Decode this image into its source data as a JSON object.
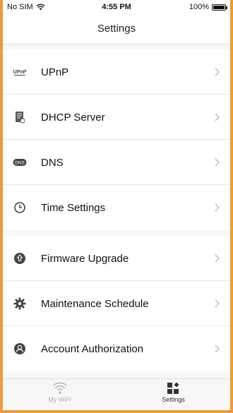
{
  "status_bar": {
    "carrier": "No SIM",
    "time": "4:55 PM",
    "battery": "100%"
  },
  "nav": {
    "title": "Settings"
  },
  "groups": [
    [
      {
        "label": "UPnP",
        "icon": "upnp-icon"
      },
      {
        "label": "DHCP Server",
        "icon": "dhcp-icon"
      },
      {
        "label": "DNS",
        "icon": "dns-icon"
      },
      {
        "label": "Time Settings",
        "icon": "clock-icon"
      }
    ],
    [
      {
        "label": "Firmware Upgrade",
        "icon": "firmware-upgrade-icon"
      },
      {
        "label": "Maintenance Schedule",
        "icon": "gear-icon"
      },
      {
        "label": "Account Authorization",
        "icon": "account-icon"
      }
    ]
  ],
  "tabs": [
    {
      "label": "My WiFi",
      "icon": "wifi-icon",
      "active": false
    },
    {
      "label": "Settings",
      "icon": "settings-grid-icon",
      "active": true
    }
  ],
  "upnp_icon_text": "UPnP",
  "dns_icon_text": "DNS",
  "colors": {
    "accent_border": "#EE9A3C",
    "icon_dark": "#444444",
    "chevron": "#c4c4c4"
  }
}
